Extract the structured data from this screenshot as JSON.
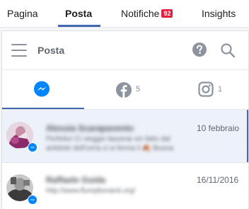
{
  "topnav": {
    "tabs": [
      {
        "label": "Pagina"
      },
      {
        "label": "Posta"
      },
      {
        "label": "Notifiche",
        "badge": "92"
      },
      {
        "label": "Insights"
      }
    ]
  },
  "header": {
    "title": "Posta",
    "icons": [
      "hamburger-icon",
      "help-icon",
      "search-icon"
    ]
  },
  "filters": [
    {
      "icon": "messenger-icon",
      "count": ""
    },
    {
      "icon": "facebook-icon",
      "count": "5"
    },
    {
      "icon": "instagram-icon",
      "count": "1"
    }
  ],
  "conversations": [
    {
      "name": "Alessia Scarapavento",
      "snippet_line1": "Perfetto! Ci vieggio lasserai vin fatto dal",
      "snippet_line2": "antidote dell'ceria ci si ferma il 🍂 Buona",
      "date": "10 febbraio",
      "selected": true
    },
    {
      "name": "Raffaele Guida",
      "snippet_line1": "http://www.flumpbonanti.org/",
      "snippet_line2": "",
      "date": "16/11/2016",
      "selected": false
    }
  ],
  "colors": {
    "accent": "#4267b2",
    "badge": "#e41e3f",
    "selected_row": "#edf2fa",
    "messenger": "#0084ff"
  }
}
